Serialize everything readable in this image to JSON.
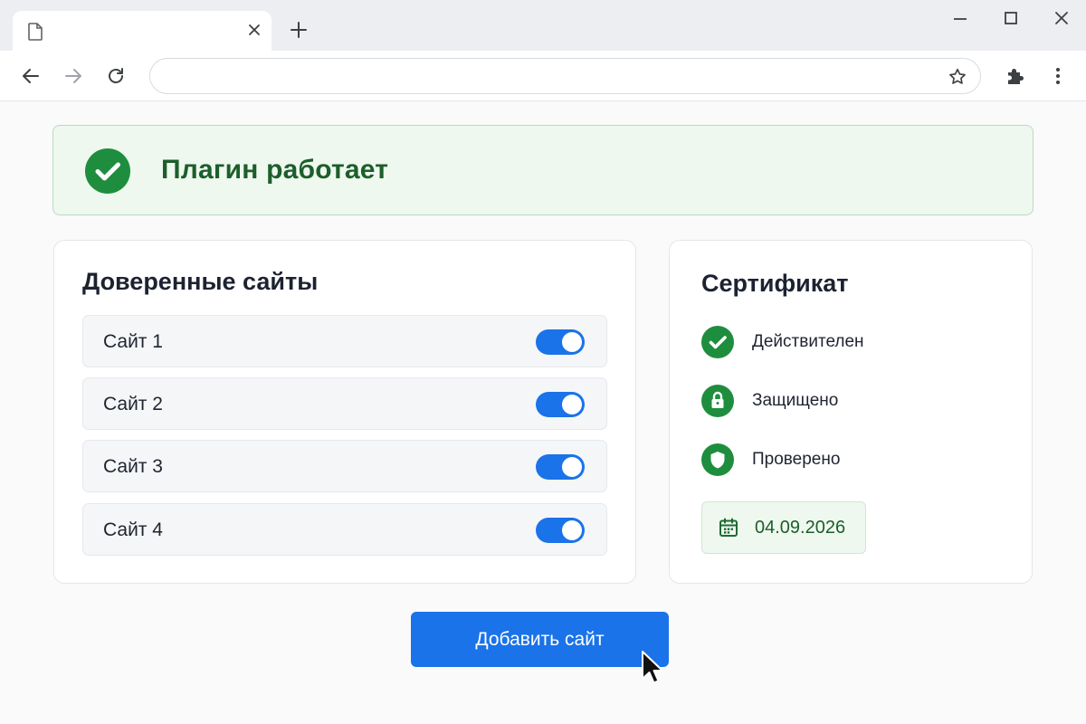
{
  "browser": {
    "tab": {
      "title": "",
      "page_icon": "page-icon",
      "close_icon": "close-icon"
    },
    "new_tab_icon": "plus-icon",
    "window_controls": [
      "minimize-icon",
      "maximize-icon",
      "close-icon"
    ],
    "toolbar": {
      "back_icon": "arrow-left-icon",
      "forward_icon": "arrow-right-icon",
      "reload_icon": "reload-icon",
      "address": {
        "value": "",
        "placeholder": ""
      },
      "bookmark_icon": "star-icon",
      "extensions_icon": "puzzle-icon",
      "menu_icon": "more-vertical-icon"
    }
  },
  "status": {
    "icon": "check-circle-icon",
    "text": "Плагин работает"
  },
  "trusted_sites": {
    "title": "Доверенные сайты",
    "items": [
      {
        "label": "Сайт 1",
        "enabled": true
      },
      {
        "label": "Сайт 2",
        "enabled": true
      },
      {
        "label": "Сайт 3",
        "enabled": true
      },
      {
        "label": "Сайт 4",
        "enabled": true
      }
    ]
  },
  "certificate": {
    "title": "Сертификат",
    "items": [
      {
        "icon": "check-circle-icon",
        "label": "Действителен"
      },
      {
        "icon": "lock-icon",
        "label": "Защищено"
      },
      {
        "icon": "shield-icon",
        "label": "Проверено"
      }
    ],
    "date_icon": "calendar-icon",
    "date": "04.09.2026"
  },
  "add_site_button": {
    "label": "Добавить сайт"
  },
  "colors": {
    "accent_blue": "#1a73e8",
    "success_green": "#1e8e3e",
    "success_text": "#1d5e2a",
    "success_bg": "#eef8ef"
  }
}
